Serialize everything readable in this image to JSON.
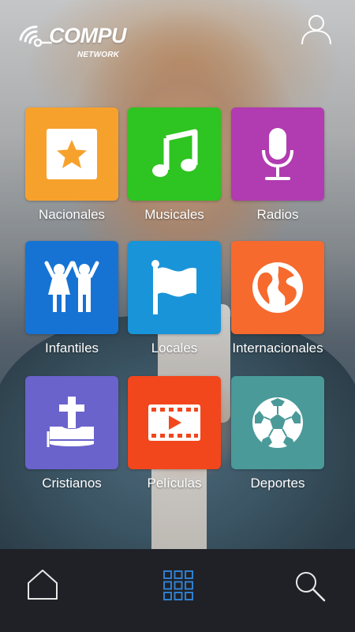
{
  "brand": {
    "name": "COMPU",
    "sub": "NETWORK"
  },
  "header": {
    "user_icon": "user-icon"
  },
  "categories": [
    {
      "label": "Nacionales",
      "icon": "star-icon",
      "color": "#f7a12d"
    },
    {
      "label": "Musicales",
      "icon": "music-note-icon",
      "color": "#2ec421"
    },
    {
      "label": "Radios",
      "icon": "microphone-icon",
      "color": "#b13bb1"
    },
    {
      "label": "Infantiles",
      "icon": "children-icon",
      "color": "#1673d4"
    },
    {
      "label": "Locales",
      "icon": "flag-icon",
      "color": "#1a94d8"
    },
    {
      "label": "Internacionales",
      "icon": "globe-icon",
      "color": "#f66a2e"
    },
    {
      "label": "Cristianos",
      "icon": "bible-cross-icon",
      "color": "#6a63cc"
    },
    {
      "label": "Películas",
      "icon": "film-icon",
      "color": "#f2461c"
    },
    {
      "label": "Deportes",
      "icon": "soccer-ball-icon",
      "color": "#4a9a99"
    }
  ],
  "nav": {
    "home_icon": "home-icon",
    "grid_icon": "grid-icon",
    "search_icon": "search-icon",
    "active_color": "#2f7fd0"
  }
}
